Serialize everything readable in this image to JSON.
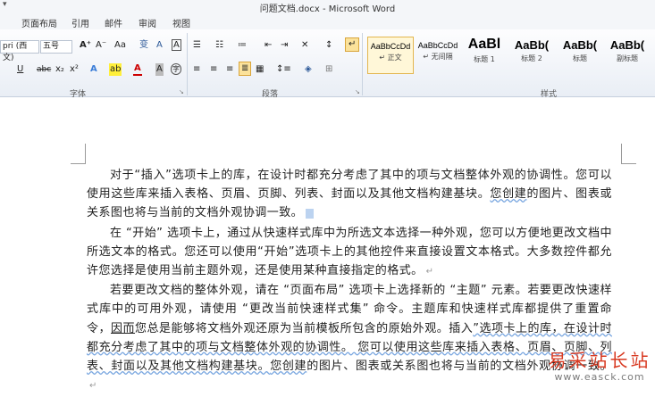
{
  "app": {
    "window_title": "问题文档.docx - Microsoft Word",
    "quick_access": "▾"
  },
  "tabs": [
    "页面布局",
    "引用",
    "邮件",
    "审阅",
    "视图"
  ],
  "ribbon": {
    "font_group": {
      "label": "字体",
      "font_name": "pri (西文)",
      "font_size": "五号",
      "grow_font": "A⁺",
      "shrink_font": "A⁻",
      "change_case": "Aa",
      "clear_format": "A",
      "bold": "B",
      "underline": "U",
      "strikethrough": "abc",
      "subscript": "x₂",
      "superscript": "x²",
      "text_effects": "A",
      "highlight": "ab",
      "font_color": "A",
      "char_shading": "A",
      "enclose": "字",
      "phonetic": "变",
      "char_border": "A"
    },
    "paragraph_group": {
      "label": "段落"
    },
    "styles_group": {
      "label": "样式",
      "styles": [
        {
          "sample": "AaBbCcDd",
          "name": "↵ 正文",
          "active": true
        },
        {
          "sample": "AaBbCcDd",
          "name": "↵ 无间隔",
          "active": false
        },
        {
          "sample": "AaBl",
          "name": "标题 1",
          "active": false
        },
        {
          "sample": "AaBb(",
          "name": "标题 2",
          "active": false
        },
        {
          "sample": "AaBb(",
          "name": "标题",
          "active": false
        },
        {
          "sample": "AaBb(",
          "name": "副标题",
          "active": false
        }
      ]
    }
  },
  "document": {
    "paragraphs": [
      {
        "a": "对于“插入”选项卡上的库，在设计时都充分考虑了其中的项与文档整体外观的协调性。您可以使用这些库来插入表格、页眉、页脚、列表、封面以及其他文档构建基块。",
        "b": "您创建",
        "c": "的图片、图表或关系图也将与当前的文档外观协调一致。"
      },
      {
        "a": "在 “开始” 选项卡上，通过从快速样式库中为所选文本选择一种外观，您可以方便地更改文档中所选文本的格式。您还可以使用“开始”选项卡上的其他控件来直接设置文本格式。大多数控件都允许您选择是使用当前主题外观，还是使用某种直接指定的格式。"
      },
      {
        "a": "若要更改文档的整体外观，请在 “页面布局” 选项卡上选择新的 “主题” 元素。若要更改快速样式库中的可用外观，请使用 “更改当前快速样式集” 命令。主题库和快速样式库都提供了重置命令，",
        "b": "因而",
        "c": "您总是能够将文档外观还原为当前模板所包含的原始外观。插入",
        "d": "”选项卡上的库，在设计时都充分考虑了其中的项与文档整体外观的协调性。 您可以使用这些库来插入表格、页眉、页脚、列表、封面以及其他文档构建基块。",
        "e": "您创建",
        "f": "的图片、图表或关系图也将与当前的文档外观协调一致。"
      }
    ]
  },
  "watermark": {
    "text": "易采站长站",
    "url": "www.easck.com"
  },
  "colors": {
    "ribbon_bg": "#e9eef5",
    "active_style_border": "#e3b64f",
    "watermark_red": "#d83a22"
  }
}
